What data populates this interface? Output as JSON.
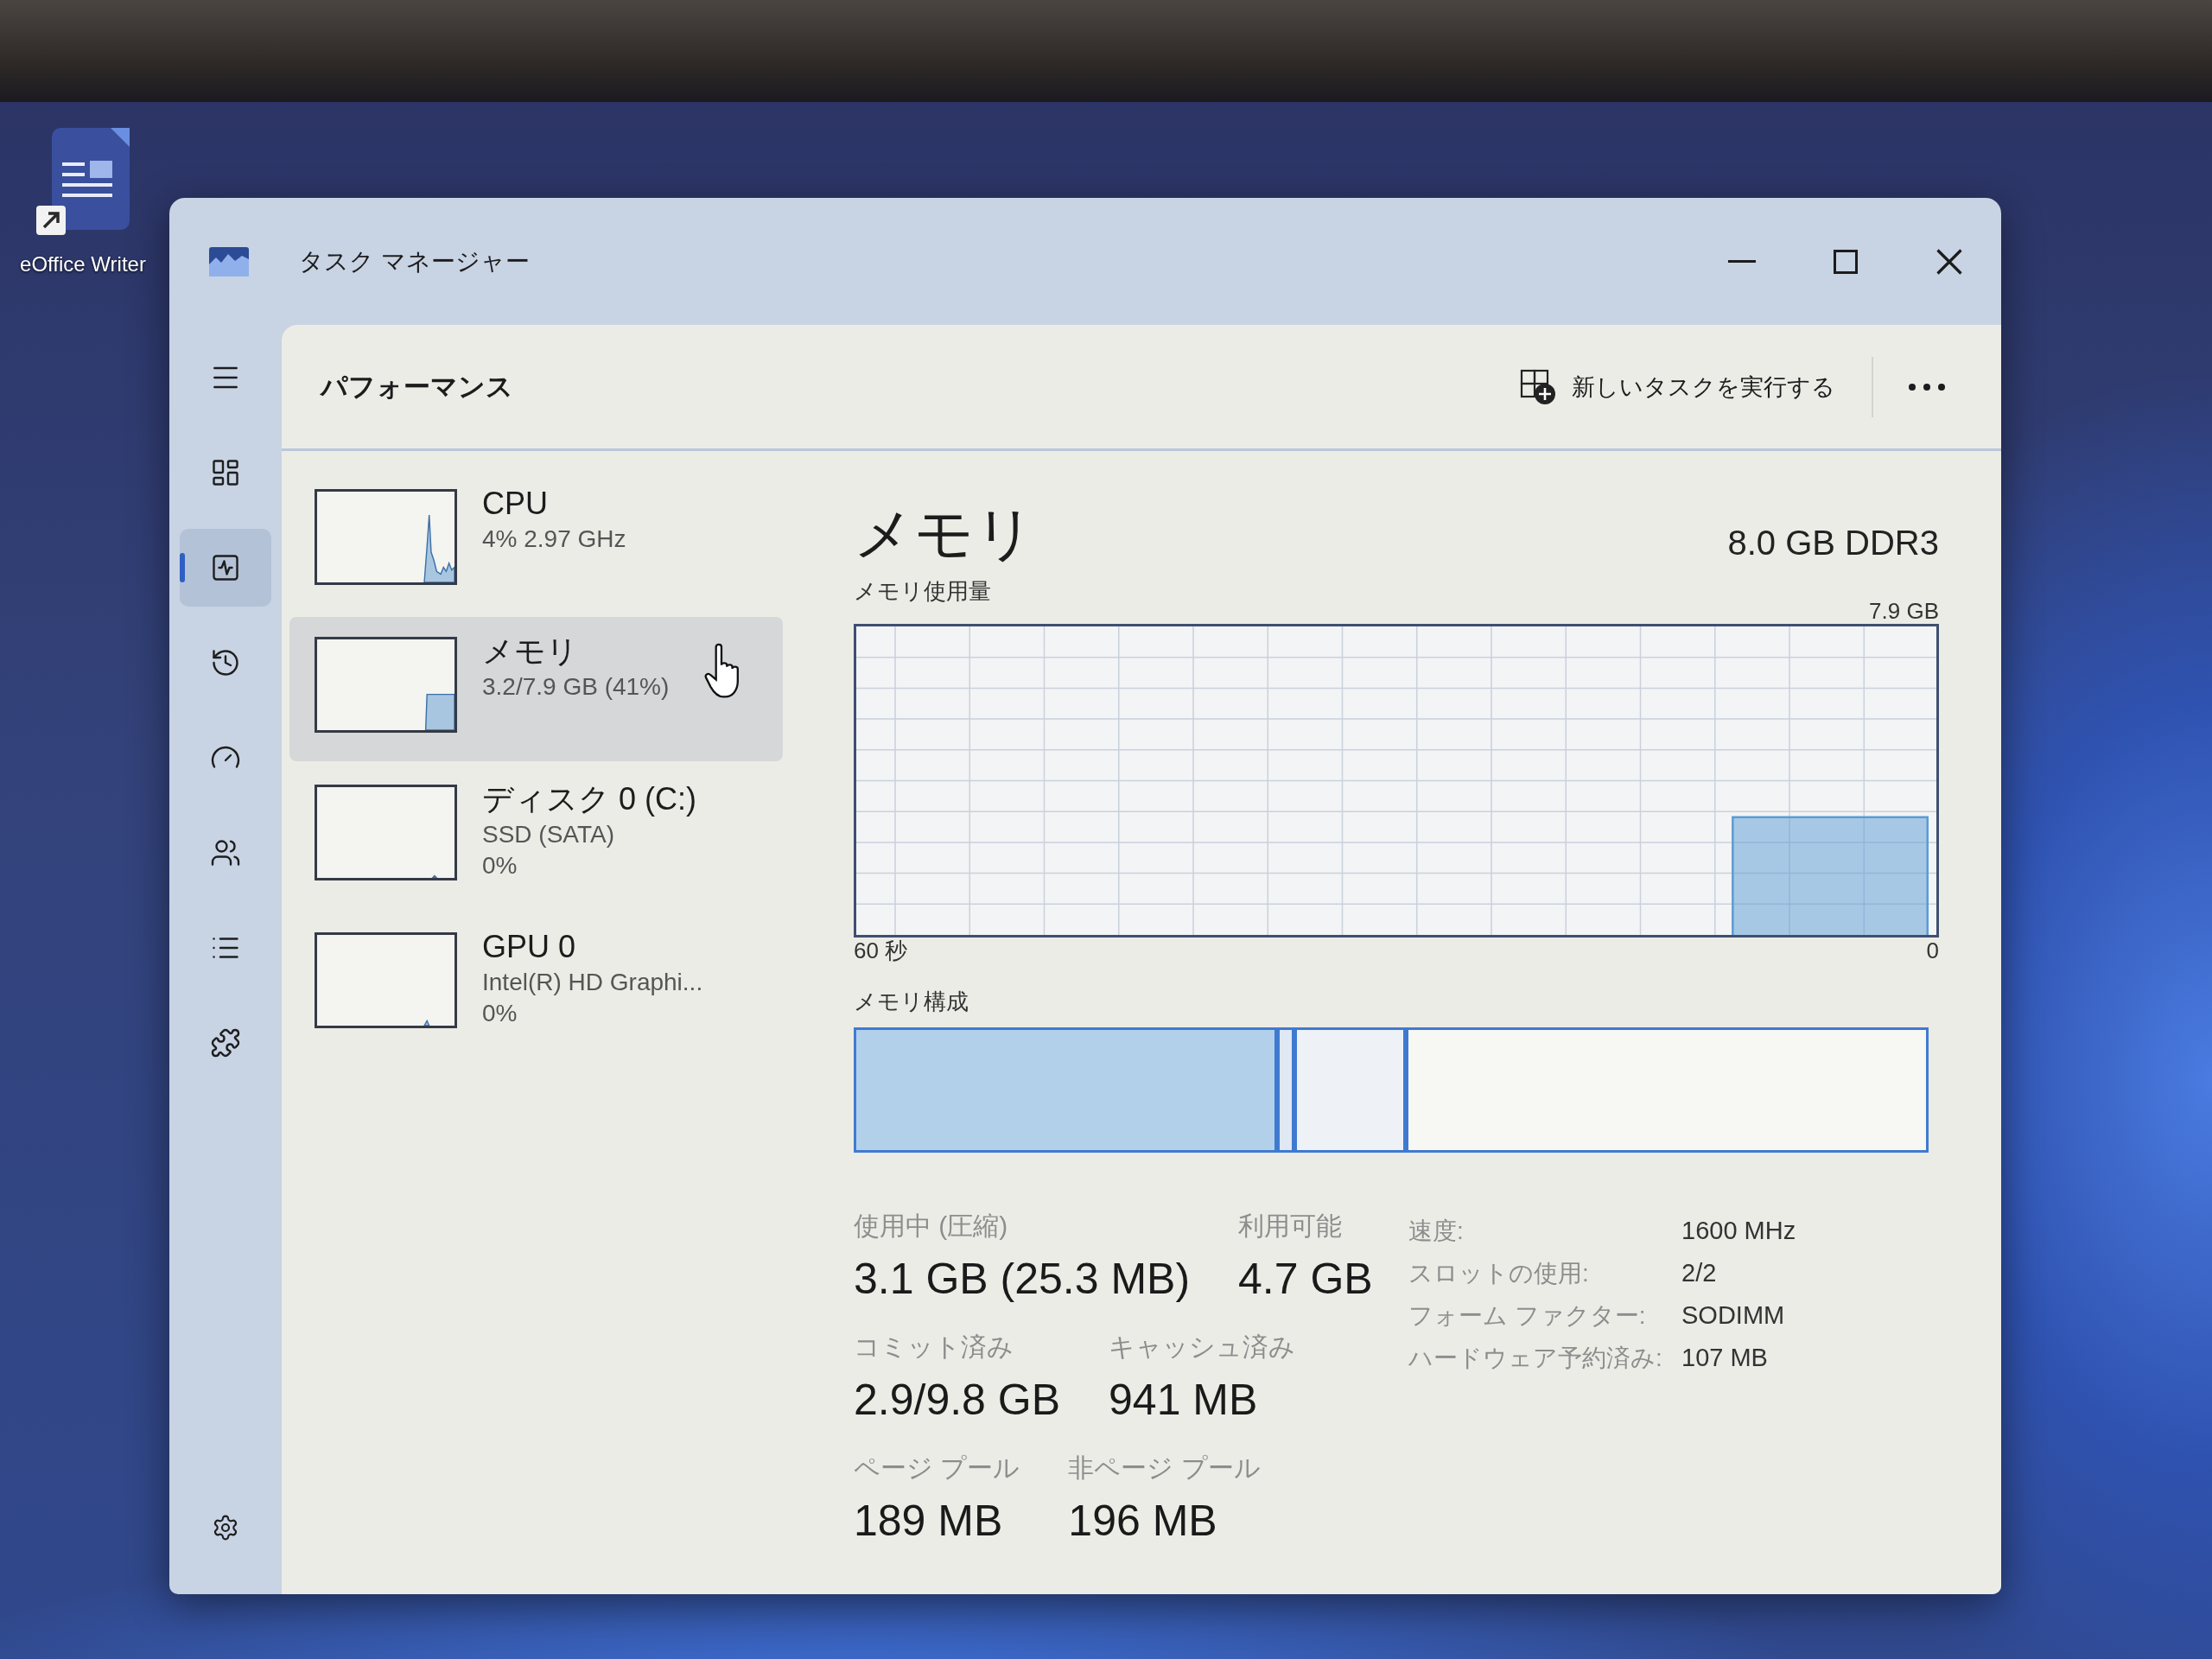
{
  "desktop": {
    "shortcut": {
      "label": "eOffice Writer"
    }
  },
  "window": {
    "title": "タスク マネージャー"
  },
  "nav": {
    "items": [
      {
        "kind": "processes",
        "selected": false
      },
      {
        "kind": "performance",
        "selected": true
      },
      {
        "kind": "history",
        "selected": false
      },
      {
        "kind": "startup",
        "selected": false
      },
      {
        "kind": "users",
        "selected": false
      },
      {
        "kind": "details",
        "selected": false
      },
      {
        "kind": "services",
        "selected": false
      }
    ]
  },
  "header": {
    "title": "パフォーマンス",
    "run_task_button": {
      "label": "新しいタスクを実行する"
    }
  },
  "resources": [
    {
      "kind": "cpu",
      "name": "CPU",
      "lines": [
        "4% 2.97 GHz"
      ],
      "selected": false
    },
    {
      "kind": "memory",
      "name": "メモリ",
      "lines": [
        "3.2/7.9 GB (41%)"
      ],
      "selected": true
    },
    {
      "kind": "disk",
      "name": "ディスク 0 (C:)",
      "lines": [
        "SSD (SATA)",
        "0%"
      ],
      "selected": false
    },
    {
      "kind": "gpu",
      "name": "GPU 0",
      "lines": [
        "Intel(R) HD Graphi...",
        "0%"
      ],
      "selected": false
    }
  ],
  "detail": {
    "title": "メモリ",
    "subtitle": "8.0 GB DDR3",
    "usage_chart": {
      "chart_data": {
        "type": "area",
        "title": "メモリ使用量",
        "grid": true,
        "categories": [
          null,
          null,
          null,
          null,
          null,
          null,
          null,
          null,
          null,
          null,
          null,
          null,
          null,
          null,
          null,
          null,
          null,
          null,
          null,
          null,
          null,
          null,
          null,
          null,
          null,
          null,
          null,
          null,
          null,
          null,
          null,
          null,
          null,
          null,
          null,
          null,
          null,
          null,
          null,
          null,
          null,
          null,
          null,
          null,
          null,
          null,
          null,
          null,
          null,
          null,
          null,
          null,
          null,
          null,
          null,
          null,
          null,
          null,
          null,
          null,
          null
        ],
        "series": [
          {
            "color": "#5b9bd5",
            "values": [
              null,
              null,
              null,
              null,
              null,
              null,
              null,
              null,
              null,
              null,
              null,
              null,
              null,
              null,
              null,
              null,
              null,
              null,
              null,
              null,
              null,
              null,
              null,
              null,
              null,
              null,
              null,
              null,
              null,
              null,
              null,
              null,
              null,
              null,
              null,
              null,
              null,
              null,
              null,
              null,
              null,
              null,
              null,
              null,
              null,
              null,
              null,
              null,
              null,
              3.1,
              3.1,
              3.1,
              3.1,
              3.1,
              3.1,
              3.1,
              3.1,
              3.1,
              3.1,
              3.1,
              3.1
            ]
          }
        ],
        "ylim": [
          0,
          7.9
        ],
        "yticks": [
          {
            "value": 0,
            "label": "0"
          },
          {
            "value": 7.9,
            "label": "7.9 GB"
          }
        ],
        "annotations": [
          "60 秒"
        ]
      }
    },
    "composition": {
      "title": "メモリ構成"
    },
    "stats": [
      [
        {
          "label": "使用中 (圧縮)",
          "value": "3.1 GB (25.3 MB)"
        },
        {
          "label": "利用可能",
          "value": "4.7 GB"
        }
      ],
      [
        {
          "label": "コミット済み",
          "value": "2.9/9.8 GB"
        },
        {
          "label": "キャッシュ済み",
          "value": "941 MB"
        }
      ],
      [
        {
          "label": "ページ プール",
          "value": "189 MB"
        },
        {
          "label": "非ページ プール",
          "value": "196 MB"
        }
      ]
    ],
    "properties": [
      {
        "label": "速度:",
        "value": "1600 MHz"
      },
      {
        "label": "スロットの使用:",
        "value": "2/2"
      },
      {
        "label": "フォーム ファクター:",
        "value": "SODIMM"
      },
      {
        "label": "ハードウェア予約済み:",
        "value": "107 MB"
      }
    ]
  }
}
